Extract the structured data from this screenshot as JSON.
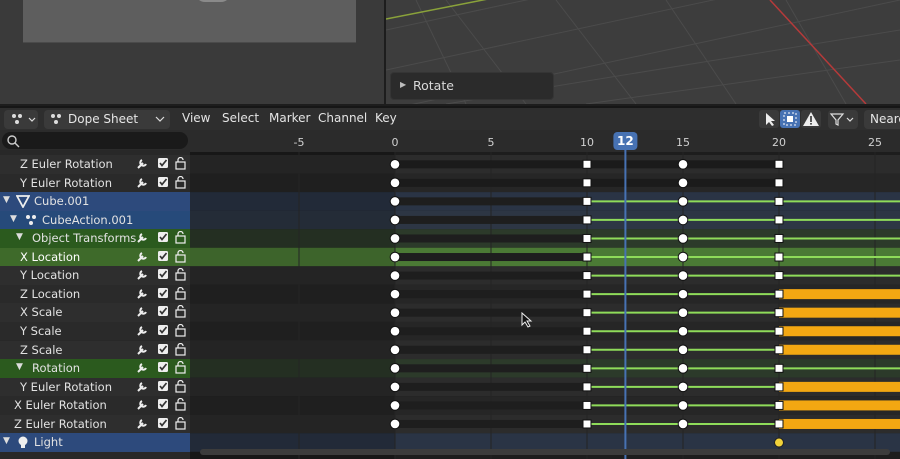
{
  "operator_panel": {
    "label": "Rotate"
  },
  "header": {
    "editor_type": "Dope Sheet",
    "menus": [
      "View",
      "Select",
      "Marker",
      "Channel",
      "Key"
    ],
    "snapping": "Neare"
  },
  "timeline": {
    "current_frame": "12",
    "ruler_labels": [
      {
        "frame": -5,
        "text": "-5"
      },
      {
        "frame": 0,
        "text": "0"
      },
      {
        "frame": 5,
        "text": "5"
      },
      {
        "frame": 10,
        "text": "10"
      },
      {
        "frame": 15,
        "text": "15"
      },
      {
        "frame": 20,
        "text": "20"
      },
      {
        "frame": 25,
        "text": "25"
      }
    ]
  },
  "channels": [
    {
      "label": "Z Euler Rotation",
      "kind": "fcurve",
      "depth": 2
    },
    {
      "label": "Y Euler Rotation",
      "kind": "fcurve",
      "depth": 2
    },
    {
      "label": "Cube.001",
      "kind": "object"
    },
    {
      "label": "CubeAction.001",
      "kind": "action"
    },
    {
      "label": "Object Transforms",
      "kind": "group"
    },
    {
      "label": "X Location",
      "kind": "fcurve",
      "selected": true
    },
    {
      "label": "Y Location",
      "kind": "fcurve"
    },
    {
      "label": "Z Location",
      "kind": "fcurve"
    },
    {
      "label": "X Scale",
      "kind": "fcurve"
    },
    {
      "label": "Y Scale",
      "kind": "fcurve"
    },
    {
      "label": "Z Scale",
      "kind": "fcurve"
    },
    {
      "label": "Rotation",
      "kind": "group"
    },
    {
      "label": "Y Euler Rotation",
      "kind": "fcurve"
    },
    {
      "label": "X Euler Rotation",
      "kind": "fcurve",
      "depth": 1
    },
    {
      "label": "Z Euler Rotation",
      "kind": "fcurve",
      "depth": 1
    },
    {
      "label": "Light",
      "kind": "object"
    }
  ],
  "keyframes": {
    "frames": [
      0,
      10,
      15,
      20
    ],
    "hold_color": "#8fdc5a",
    "selected_hold_color": "#f3a712"
  },
  "colors": {
    "accent_blue": "#4772b3",
    "object_row": "#2d4a7c",
    "action_row": "#264a7a",
    "group_row": "#2b5a1e",
    "selected_row": "#3e6a2a"
  }
}
